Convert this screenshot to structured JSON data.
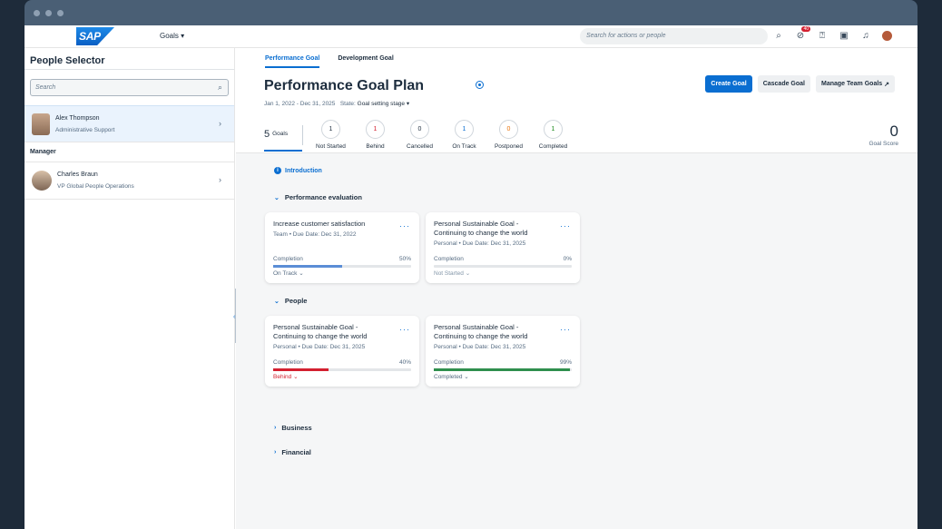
{
  "shell": {
    "logo": "SAP",
    "menu": "Goals",
    "search_placeholder": "Search for actions or people",
    "notification_badge": "40"
  },
  "left": {
    "title": "People Selector",
    "search_placeholder": "Search",
    "selected_person": {
      "name": "Alex Thompson",
      "role": "Administrative Support"
    },
    "manager_label": "Manager",
    "manager": {
      "name": "Charles Braun",
      "role": "VP Global People Operations"
    }
  },
  "tabs": [
    "Performance Goal",
    "Development Goal"
  ],
  "header": {
    "title": "Performance Goal Plan",
    "date_range": "Jan 1, 2022 - Dec 31, 2025",
    "state_label": "State:",
    "state_value": "Goal setting stage",
    "buttons": {
      "create": "Create Goal",
      "cascade": "Cascade Goal",
      "manage": "Manage Team Goals"
    },
    "goals_count": "5",
    "goals_label": "Goals",
    "counters": [
      {
        "value": "1",
        "label": "Not Started",
        "color": "#1d2d3e"
      },
      {
        "value": "1",
        "label": "Behind",
        "color": "#d32030"
      },
      {
        "value": "0",
        "label": "Cancelled",
        "color": "#1d2d3e"
      },
      {
        "value": "1",
        "label": "On Track",
        "color": "#0a6ed1"
      },
      {
        "value": "0",
        "label": "Postponed",
        "color": "#e9730c"
      },
      {
        "value": "1",
        "label": "Completed",
        "color": "#188918"
      }
    ],
    "score_value": "0",
    "score_label": "Goal Score"
  },
  "content": {
    "intro": "Introduction",
    "groups": {
      "performance": "Performance evaluation",
      "people": "People",
      "business": "Business",
      "financial": "Financial"
    },
    "cards": [
      {
        "name": "Increase customer satisfaction",
        "meta": "Team • Due Date: Dec 31, 2022",
        "completion_label": "Completion",
        "pct": "50%",
        "progress": 0.5,
        "bar_color": "#5b8dd6",
        "status": "On Track",
        "status_color": "#556b82"
      },
      {
        "name": "Personal Sustainable Goal - Continuing to change the world",
        "meta": "Personal • Due Date: Dec 31, 2025",
        "completion_label": "Completion",
        "pct": "0%",
        "progress": 0.0,
        "bar_color": "#5b8dd6",
        "status": "Not Started",
        "status_color": "#8396a8"
      },
      {
        "name": "Personal Sustainable Goal - Continuing to change the world",
        "meta": "Personal • Due Date: Dec 31, 2025",
        "completion_label": "Completion",
        "pct": "40%",
        "progress": 0.4,
        "bar_color": "#d32030",
        "status": "Behind",
        "status_color": "#d32030"
      },
      {
        "name": "Personal Sustainable Goal - Continuing to change the world",
        "meta": "Personal • Due Date: Dec 31, 2025",
        "completion_label": "Completion",
        "pct": "99%",
        "progress": 0.99,
        "bar_color": "#2f8f4e",
        "status": "Completed",
        "status_color": "#556b82"
      }
    ]
  }
}
